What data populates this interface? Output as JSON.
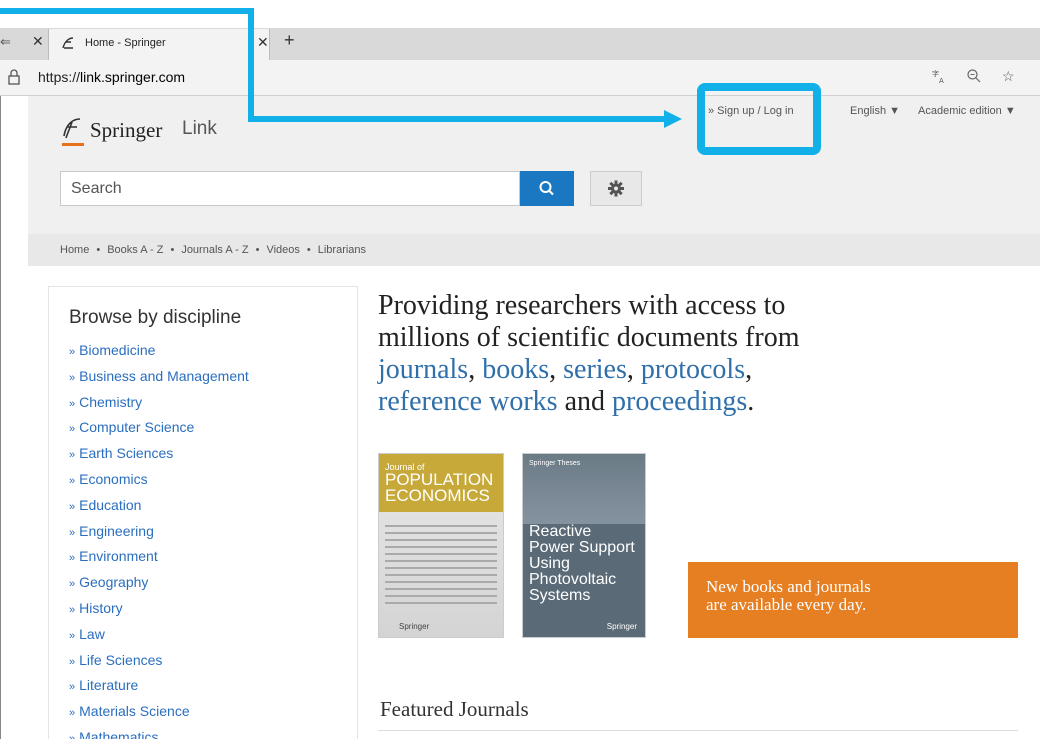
{
  "browser": {
    "prev_tab_icon": "tab-list-icon",
    "active_tab_title": "Home - Springer",
    "url_prefix": "https://",
    "url_host": "link.springer.com"
  },
  "header": {
    "logo_main": "Springer",
    "logo_link": "Link",
    "signup": "» Sign up / Log in",
    "language": "English ▼",
    "edition": "Academic edition ▼"
  },
  "search": {
    "placeholder": "Search"
  },
  "nav": {
    "items": [
      "Home",
      "Books A - Z",
      "Journals A - Z",
      "Videos",
      "Librarians"
    ],
    "separator": "•"
  },
  "sidebar": {
    "title": "Browse by discipline",
    "items": [
      "Biomedicine",
      "Business and Management",
      "Chemistry",
      "Computer Science",
      "Earth Sciences",
      "Economics",
      "Education",
      "Engineering",
      "Environment",
      "Geography",
      "History",
      "Law",
      "Life Sciences",
      "Literature",
      "Materials Science",
      "Mathematics"
    ]
  },
  "hero": {
    "line1": "Providing researchers with access to",
    "line2": "millions of scientific documents from",
    "journals": "journals",
    "books": "books",
    "series": "series",
    "protocols": "protocols",
    "reference_works": "reference works",
    "and": "and",
    "proceedings": "proceedings",
    "comma": ",",
    "period": "."
  },
  "books": {
    "book1_sub": "Journal of",
    "book1_title1": "POPULATION",
    "book1_title2": "ECONOMICS",
    "book1_pub": "Springer",
    "book2_series": "Springer Theses",
    "book2_title": "Reactive Power Support Using Photovoltaic Systems",
    "book2_pub": "Springer"
  },
  "promo": {
    "line1": "New books and journals",
    "line2": "are available every day."
  },
  "featured_title": "Featured Journals",
  "colors": {
    "annotation": "#12b0e8",
    "link_blue": "#2a6ebf",
    "promo_orange": "#e67e22",
    "search_blue": "#1a78c2"
  }
}
